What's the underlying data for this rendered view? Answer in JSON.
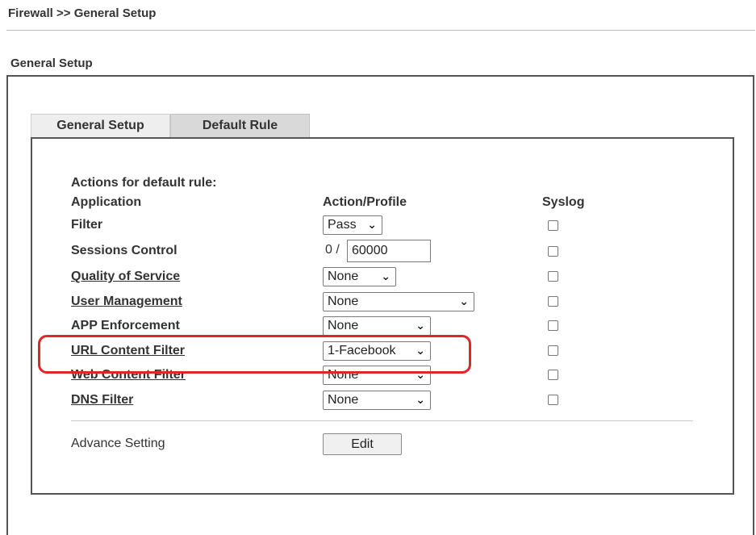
{
  "breadcrumb": "Firewall >> General Setup",
  "section_title": "General Setup",
  "tabs": [
    {
      "label": "General Setup",
      "active": false
    },
    {
      "label": "Default Rule",
      "active": true
    }
  ],
  "actions_title": "Actions for default rule:",
  "columns": {
    "application": "Application",
    "action": "Action/Profile",
    "syslog": "Syslog"
  },
  "rows": {
    "filter": {
      "label": "Filter",
      "value": "Pass",
      "syslog": false
    },
    "sessions": {
      "label": "Sessions Control",
      "prefix": "0 /",
      "value": "60000",
      "syslog": false
    },
    "qos": {
      "label": "Quality of Service",
      "value": "None",
      "syslog": false
    },
    "user_mgmt": {
      "label": "User Management",
      "value": "None",
      "syslog": false
    },
    "app_enf": {
      "label": "APP Enforcement",
      "value": "None",
      "syslog": false
    },
    "url_filter": {
      "label": "URL Content Filter",
      "value": "1-Facebook",
      "syslog": false
    },
    "web_filter": {
      "label": "Web Content Filter",
      "value": "None",
      "syslog": false
    },
    "dns_filter": {
      "label": "DNS Filter",
      "value": "None",
      "syslog": false
    }
  },
  "advance": {
    "label": "Advance Setting",
    "button": "Edit"
  },
  "icons": {
    "dropdown": "chevron-down-icon"
  },
  "colors": {
    "highlight": "#e0262b",
    "tab_active": "#d9d9d9",
    "tab_inactive": "#eeeeee"
  }
}
